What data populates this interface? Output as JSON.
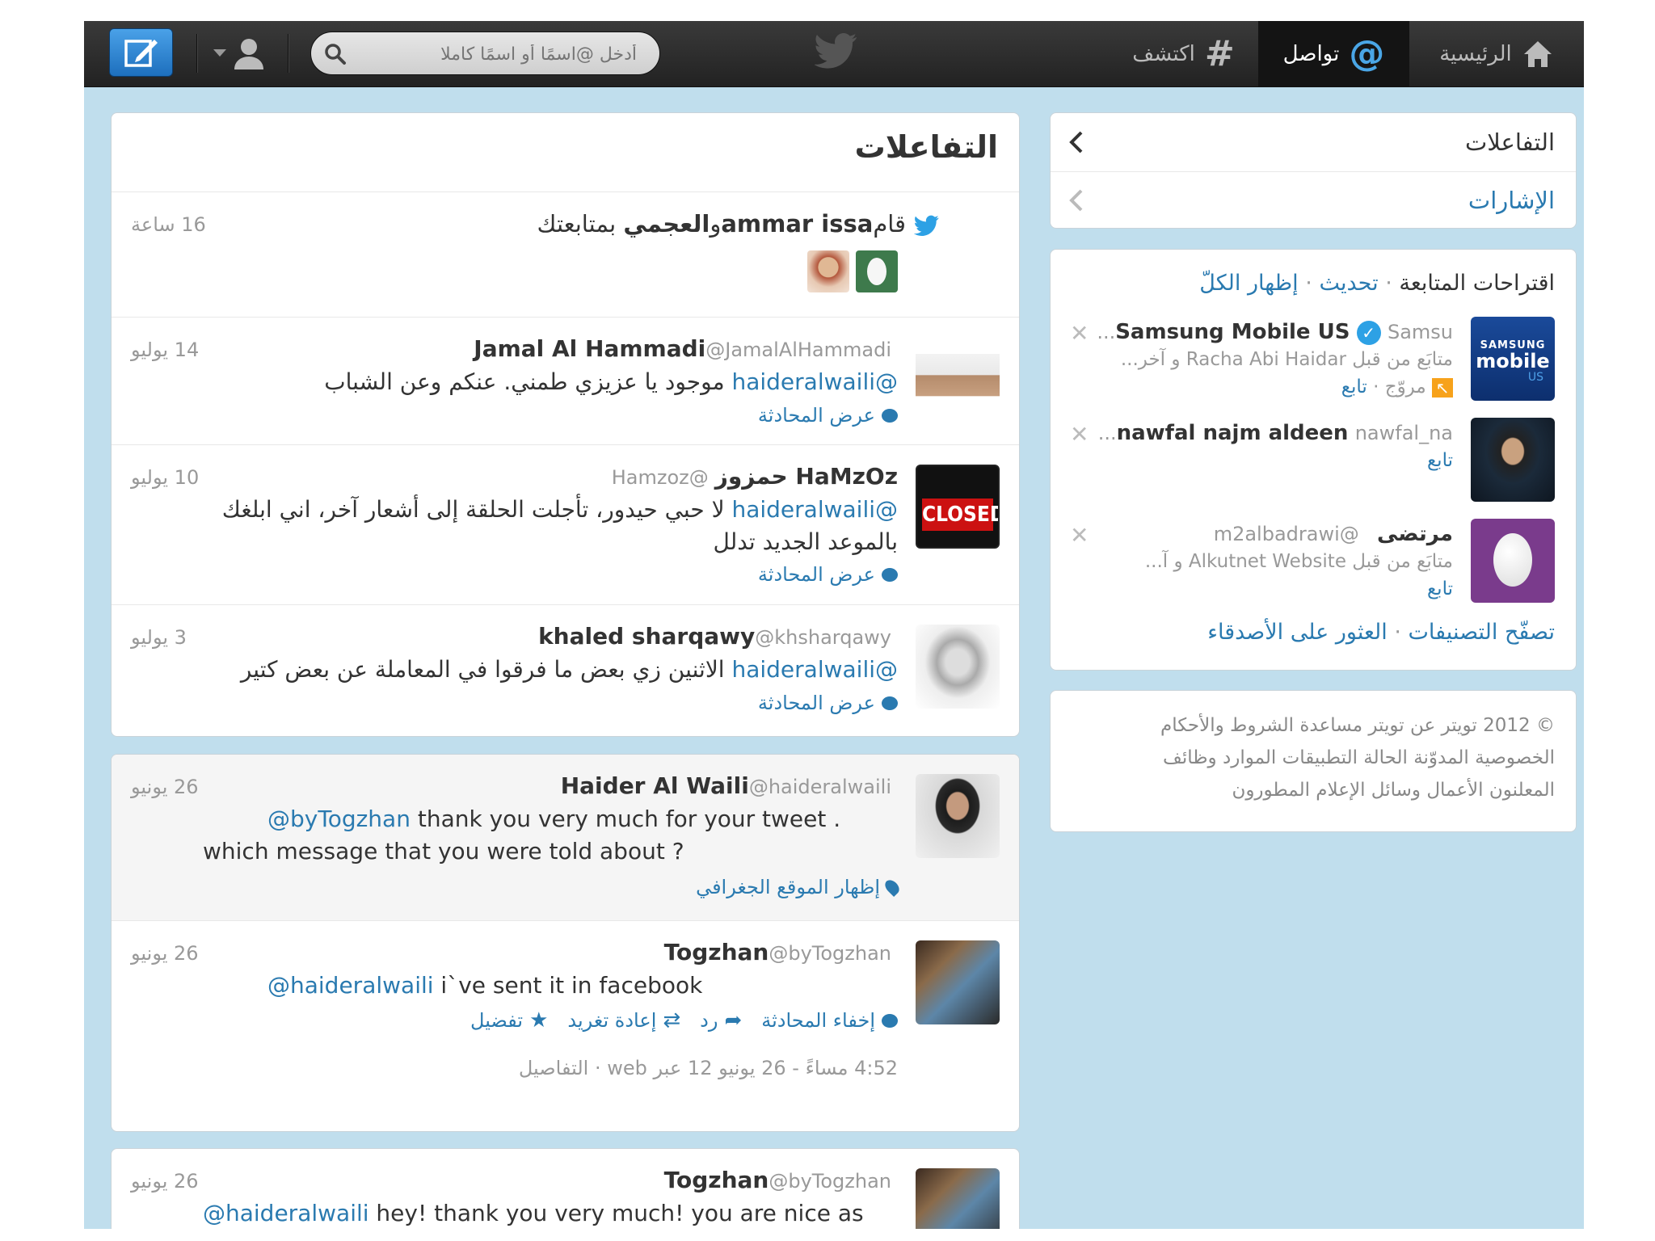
{
  "nav": {
    "home": "الرئيسية",
    "connect": "تواصل",
    "discover": "اكتشف",
    "search_placeholder": "أدخل @اسمًا أو اسمًا كاملا"
  },
  "stream": {
    "title": "التفاعلات",
    "follow_event": {
      "prefix": "قام",
      "user1": "ammar issa",
      "and": "و",
      "user2": "العجمي",
      "suffix": " بمتابعتك",
      "time": "16 ساعة"
    },
    "tweets": [
      {
        "name": "Jamal Al Hammadi",
        "screen_name": "@JamalAlHammadi",
        "time": "14 يوليو",
        "mention": "@haideralwaili",
        "text": " موجود يا عزيزي طمني. عنكم وعن الشباب",
        "action": "عرض المحادثة"
      },
      {
        "name": "HaMzOz حمزوز",
        "screen_name": "@Hamzoz",
        "time": "10 يوليو",
        "mention": "@haideralwaili",
        "text": " لا حبي حيدور، تأجلت الحلقة إلى أشعار آخر، اني ابلغك بالموعد الجديد تدلل",
        "action": "عرض المحادثة"
      },
      {
        "name": "khaled sharqawy",
        "screen_name": "@khsharqawy",
        "time": "3 يوليو",
        "mention": "@haideralwaili",
        "text": " الاثنين زي بعض ما فرقوا في المعاملة عن بعض كتير",
        "action": "عرض المحادثة"
      },
      {
        "name": "Haider Al Waili",
        "screen_name": "@haideralwaili",
        "time": "26 يونيو",
        "mention": "@byTogzhan",
        "text": " thank you very much for your tweet . which message that you were told about ?",
        "action": "إظهار الموقع الجغرافي"
      },
      {
        "name": "Togzhan",
        "screen_name": "@byTogzhan",
        "time": "26 يونيو",
        "mention": "@haideralwaili",
        "text": " i`ve sent it in facebook",
        "actions": {
          "hide": "إخفاء المحادثة",
          "reply": "رد",
          "retweet": "إعادة تغريد",
          "favorite": "تفضيل"
        },
        "details_time": "4:52 مساءً - 26 يونيو 12 عبر web",
        "details_link": "التفاصيل"
      },
      {
        "name": "Togzhan",
        "screen_name": "@byTogzhan",
        "time": "26 يونيو",
        "mention": "@haideralwaili",
        "text": " hey! thank you very much! you are nice as always) btw, i have a question to you. will write you personal msg"
      }
    ]
  },
  "sidebar": {
    "interactions": "التفاعلات",
    "mentions": "الإشارات",
    "wtf": {
      "title": "اقتراحات المتابعة",
      "refresh": "تحديث",
      "view_all": "إظهار الكلّ",
      "sep": "·",
      "follow": "تابع",
      "items": [
        {
          "name": "Samsung Mobile US",
          "screen_name": "Samsu...",
          "context": "متابَع من قبل Racha Abi Haidar و آخر...",
          "promoted": "مروّج",
          "logo_line1": "SAMSUNG",
          "logo_line2": "mobile",
          "logo_line3": "US"
        },
        {
          "name": "nawfal najm aldeen",
          "screen_name": "nawfal_na..."
        },
        {
          "name": "مرتضى",
          "screen_name": "@m2albadrawi",
          "context": "متابَع من قبل Alkutnet Website و آ..."
        }
      ],
      "browse": "تصفّح التصنيفات",
      "find_friends": "العثور على الأصدقاء"
    },
    "footer": {
      "line1": "© 2012 تويتر  عن تويتر  مساعدة  الشروط والأحكام",
      "line2": "الخصوصية  المدوّنة  الحالة  التطبيقات  الموارد  وظائف",
      "line3": "المعلنون  الأعمال  وسائل الإعلام  المطورون"
    }
  },
  "colors": {
    "background": "#c0deed",
    "link": "#2a7ab0",
    "topbar": "#2b2b2b",
    "promoted": "#f7a21b",
    "verified": "#2da1e5"
  }
}
